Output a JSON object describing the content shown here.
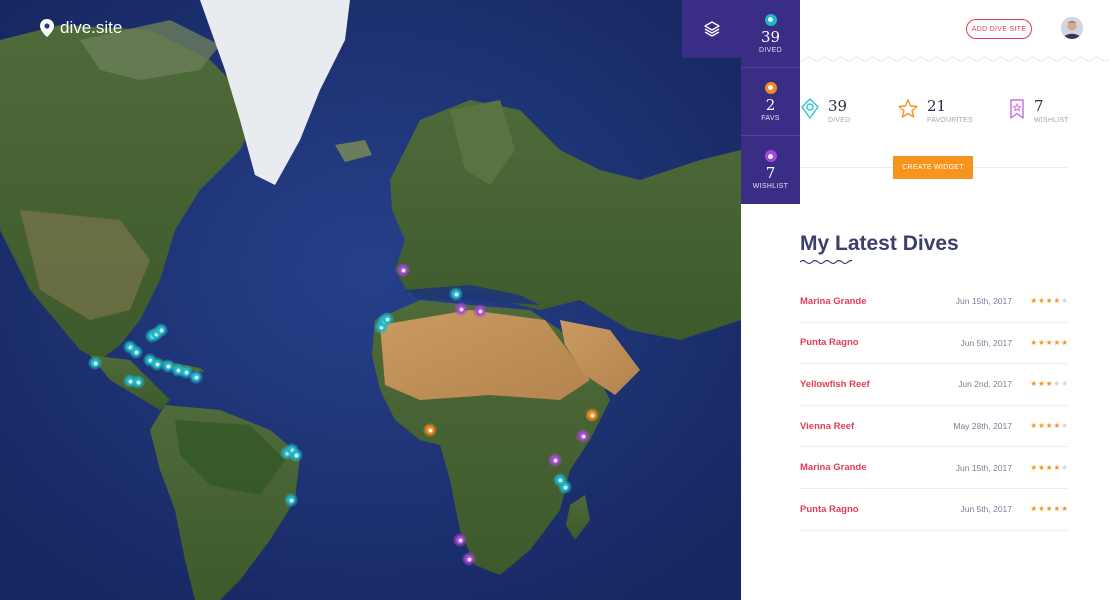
{
  "brand": {
    "name": "dive.site"
  },
  "strip": {
    "items": [
      {
        "value": "39",
        "label": "Dived",
        "color": "#1fb6c8"
      },
      {
        "value": "2",
        "label": "Favs",
        "color": "#f08a24"
      },
      {
        "value": "7",
        "label": "Wishlist",
        "color": "#a64ad6"
      }
    ]
  },
  "header": {
    "add_label": "Add dive site"
  },
  "stats": {
    "items": [
      {
        "value": "39",
        "label": "Dived",
        "icon": "dive-pin-icon",
        "color": "#2ec4d6"
      },
      {
        "value": "21",
        "label": "Favourites",
        "icon": "star-icon",
        "color": "#f7941d"
      },
      {
        "value": "7",
        "label": "Wishlist",
        "icon": "bookmark-star-icon",
        "color": "#c86be0"
      }
    ]
  },
  "widget": {
    "label": "Create widget"
  },
  "latest": {
    "title": "My Latest Dives",
    "dives": [
      {
        "name": "Marina Grande",
        "date": "Jun 15th, 2017",
        "rating": 4
      },
      {
        "name": "Punta Ragno",
        "date": "Jun 5th, 2017",
        "rating": 5
      },
      {
        "name": "Yellowfish Reef",
        "date": "Jun 2nd, 2017",
        "rating": 3
      },
      {
        "name": "Vienna Reef",
        "date": "May 28th, 2017",
        "rating": 4
      },
      {
        "name": "Marina Grande",
        "date": "Jun 15th, 2017",
        "rating": 4
      },
      {
        "name": "Punta Ragno",
        "date": "Jun 5th, 2017",
        "rating": 5
      }
    ]
  },
  "map": {
    "markers": [
      {
        "type": "dived"
      },
      {
        "type": "dived"
      },
      {
        "type": "dived"
      },
      {
        "type": "dived"
      },
      {
        "type": "dived"
      },
      {
        "type": "dived"
      },
      {
        "type": "dived"
      },
      {
        "type": "dived"
      },
      {
        "type": "dived"
      },
      {
        "type": "dived"
      },
      {
        "type": "dived"
      },
      {
        "type": "dived"
      },
      {
        "type": "dived"
      },
      {
        "type": "dived"
      },
      {
        "type": "dived"
      },
      {
        "type": "dived"
      },
      {
        "type": "dived"
      },
      {
        "type": "dived"
      },
      {
        "type": "dived"
      },
      {
        "type": "dived"
      },
      {
        "type": "dived"
      },
      {
        "type": "dived"
      },
      {
        "type": "dived"
      },
      {
        "type": "dived"
      },
      {
        "type": "wish"
      },
      {
        "type": "wish"
      },
      {
        "type": "wish"
      },
      {
        "type": "wish"
      },
      {
        "type": "wish"
      },
      {
        "type": "wish"
      },
      {
        "type": "wish"
      },
      {
        "type": "fav"
      },
      {
        "type": "fav"
      }
    ]
  }
}
